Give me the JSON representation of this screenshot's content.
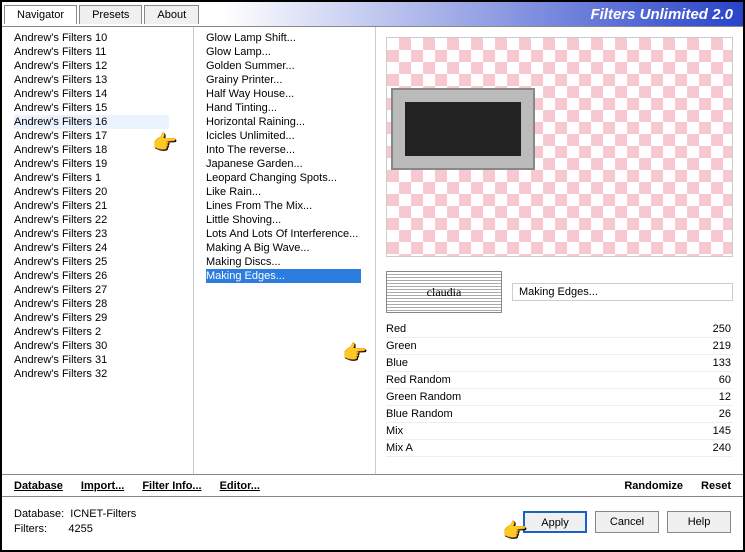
{
  "app_title": "Filters Unlimited 2.0",
  "tabs": [
    "Navigator",
    "Presets",
    "About"
  ],
  "categories": [
    "Andrew's Filters 10",
    "Andrew's Filters 11",
    "Andrew's Filters 12",
    "Andrew's Filters 13",
    "Andrew's Filters 14",
    "Andrew's Filters 15",
    "Andrew's Filters 16",
    "Andrew's Filters 17",
    "Andrew's Filters 18",
    "Andrew's Filters 19",
    "Andrew's Filters 1",
    "Andrew's Filters 20",
    "Andrew's Filters 21",
    "Andrew's Filters 22",
    "Andrew's Filters 23",
    "Andrew's Filters 24",
    "Andrew's Filters 25",
    "Andrew's Filters 26",
    "Andrew's Filters 27",
    "Andrew's Filters 28",
    "Andrew's Filters 29",
    "Andrew's Filters 2",
    "Andrew's Filters 30",
    "Andrew's Filters 31",
    "Andrew's Filters 32"
  ],
  "selected_category_index": 6,
  "filters": [
    "Glow Lamp Shift...",
    "Glow Lamp...",
    "Golden Summer...",
    "Grainy Printer...",
    "Half Way House...",
    "Hand Tinting...",
    "Horizontal Raining...",
    "Icicles Unlimited...",
    "Into The reverse...",
    "Japanese Garden...",
    "Leopard Changing Spots...",
    "Like Rain...",
    "Lines From The Mix...",
    "Little Shoving...",
    "Lots And Lots Of Interference...",
    "Making A Big Wave...",
    "Making Discs...",
    "Making Edges..."
  ],
  "selected_filter_index": 17,
  "current_filter_name": "Making Edges...",
  "logo_text": "claudia",
  "sliders": [
    {
      "label": "Red",
      "value": 250
    },
    {
      "label": "Green",
      "value": 219
    },
    {
      "label": "Blue",
      "value": 133
    },
    {
      "label": "Red Random",
      "value": 60
    },
    {
      "label": "Green Random",
      "value": 12
    },
    {
      "label": "Blue Random",
      "value": 26
    },
    {
      "label": "Mix",
      "value": 145
    },
    {
      "label": "Mix A",
      "value": 240
    }
  ],
  "toolbar": {
    "database": "Database",
    "import": "Import...",
    "filter_info": "Filter Info...",
    "editor": "Editor...",
    "randomize": "Randomize",
    "reset": "Reset"
  },
  "footer": {
    "db_label": "Database:",
    "db_value": "ICNET-Filters",
    "filters_label": "Filters:",
    "filters_value": "4255",
    "apply": "Apply",
    "cancel": "Cancel",
    "help": "Help"
  }
}
